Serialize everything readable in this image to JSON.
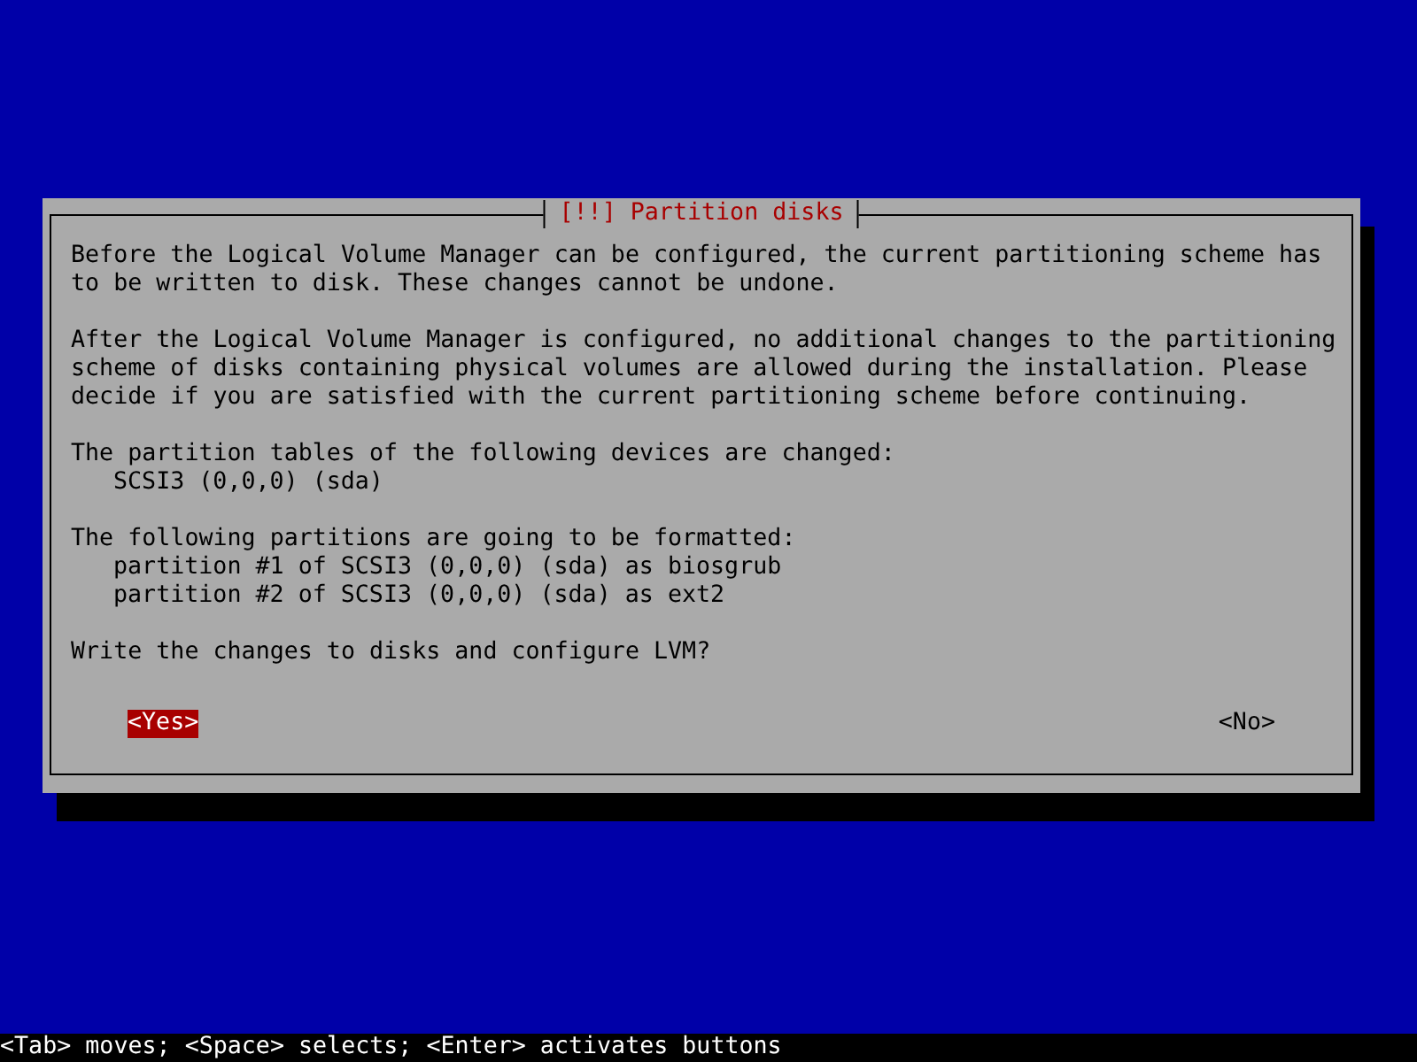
{
  "dialog": {
    "title": "[!!] Partition disks",
    "blocks": [
      {
        "kind": "text",
        "lines": [
          "Before the Logical Volume Manager can be configured, the current partitioning scheme has",
          "to be written to disk. These changes cannot be undone."
        ]
      },
      {
        "kind": "text",
        "lines": [
          "After the Logical Volume Manager is configured, no additional changes to the partitioning",
          "scheme of disks containing physical volumes are allowed during the installation. Please",
          "decide if you are satisfied with the current partitioning scheme before continuing."
        ]
      },
      {
        "kind": "list",
        "heading": "The partition tables of the following devices are changed:",
        "items": [
          "SCSI3 (0,0,0) (sda)"
        ]
      },
      {
        "kind": "list",
        "heading": "The following partitions are going to be formatted:",
        "items": [
          "partition #1 of SCSI3 (0,0,0) (sda) as biosgrub",
          "partition #2 of SCSI3 (0,0,0) (sda) as ext2"
        ]
      },
      {
        "kind": "text",
        "lines": [
          "Write the changes to disks and configure LVM?"
        ]
      }
    ],
    "buttons": [
      {
        "label": "<Yes>",
        "selected": true
      },
      {
        "label": "<No>",
        "selected": false
      }
    ]
  },
  "status_bar": "<Tab> moves; <Space> selects; <Enter> activates buttons"
}
